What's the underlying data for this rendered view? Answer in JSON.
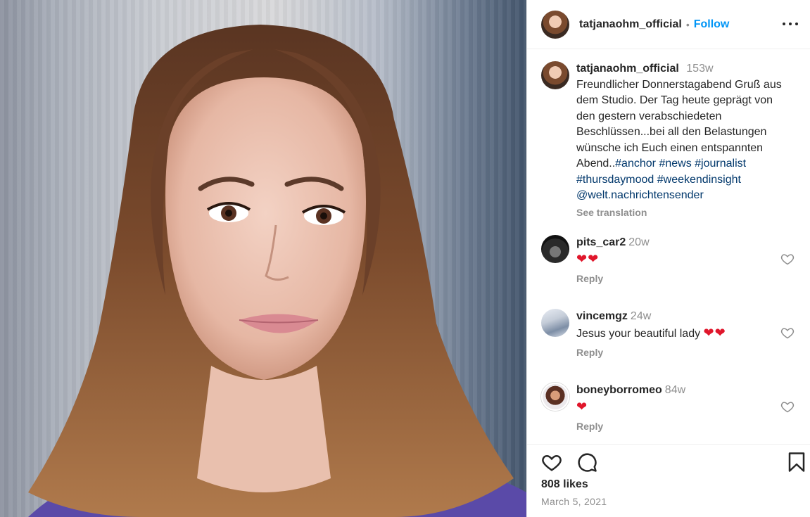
{
  "post": {
    "username": "tatjanaohm_official",
    "follow_label": "Follow",
    "dot": "•"
  },
  "caption": {
    "username": "tatjanaohm_official",
    "time": "153w",
    "text": "Freundlicher Donnerstagabend Gruß aus dem Studio. Der Tag heute geprägt von den gestern verabschiedeten Beschlüssen...bei all den Belastungen wünsche ich Euch einen entspannten Abend..",
    "tags": [
      "#anchor",
      "#news",
      "#journalist",
      "#thursdaymood",
      "#weekendinsight",
      "@welt.nachrichtensender"
    ],
    "see_translation": "See translation"
  },
  "comments": [
    {
      "username": "pits_car2",
      "time": "20w",
      "text": "❤❤",
      "reply": "Reply"
    },
    {
      "username": "vincemgz",
      "time": "24w",
      "text": "Jesus your beautiful lady ",
      "hearts": "❤❤",
      "reply": "Reply"
    },
    {
      "username": "boneyborromeo",
      "time": "84w",
      "text": "❤",
      "reply": "Reply"
    }
  ],
  "footer": {
    "likes": "808 likes",
    "date": "March 5, 2021"
  },
  "icons": {
    "like": "heart-icon",
    "comment": "comment-icon",
    "save": "bookmark-icon",
    "more": "more-options-icon"
  },
  "colors": {
    "accent": "#0095f6",
    "hashtag": "#00376b",
    "muted": "#8e8e8e",
    "heart": "#e0162b"
  }
}
